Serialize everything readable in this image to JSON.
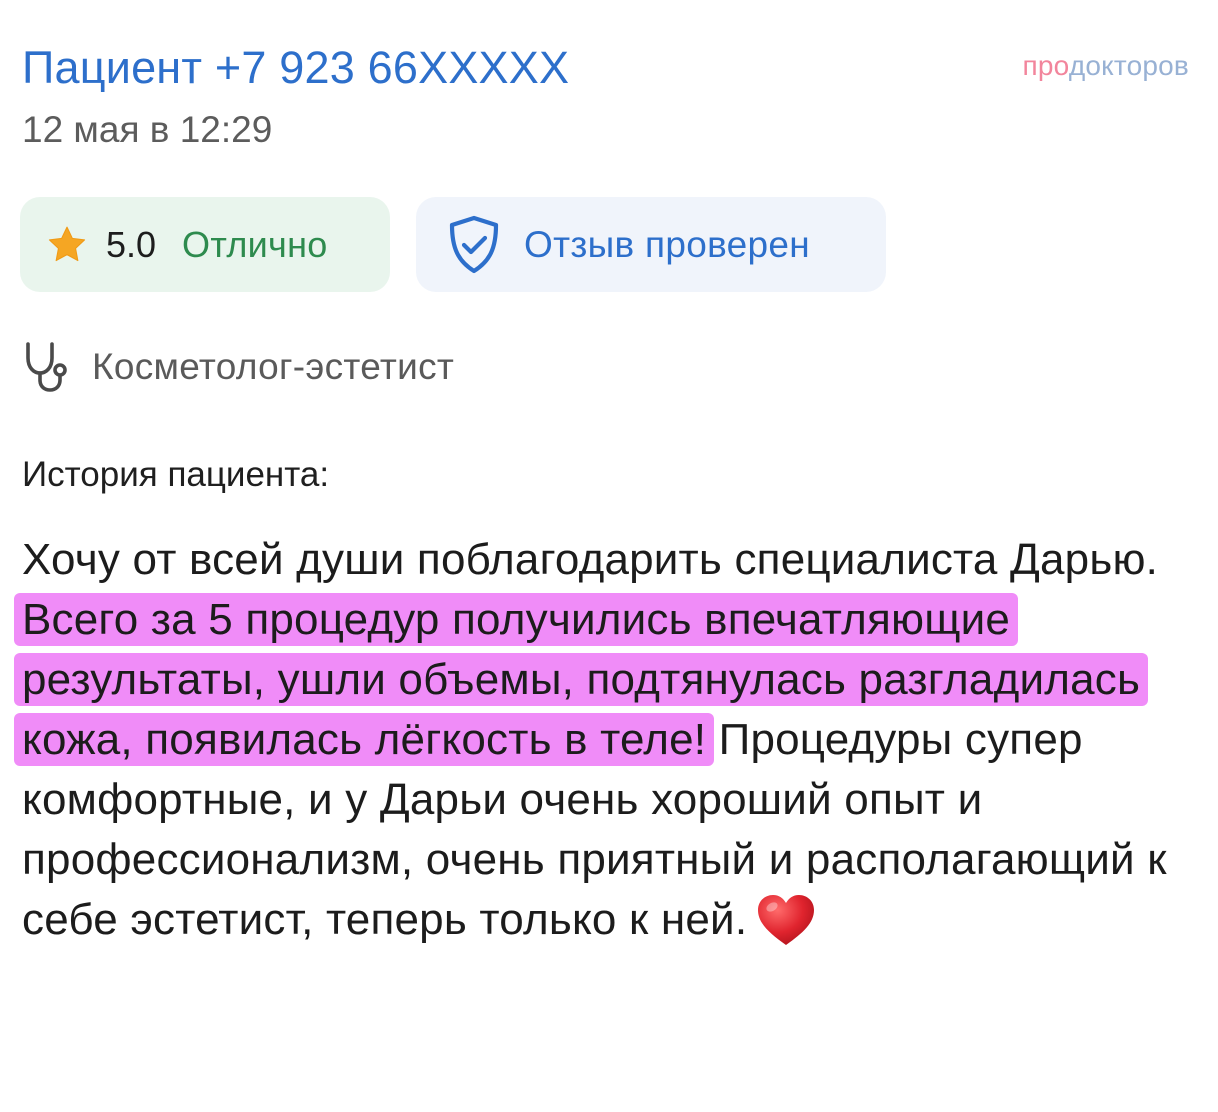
{
  "header": {
    "patient_name": "Пациент +7 923 66XXXXX",
    "date": "12 мая в 12:29",
    "brand_part1": "про",
    "brand_part2": "докторов"
  },
  "badges": {
    "rating_value": "5.0",
    "rating_text": "Отлично",
    "verified_text": "Отзыв проверен"
  },
  "specialty": "Косметолог-эстетист",
  "story": {
    "title": "История пациента:",
    "text_before": "Хочу от всей души поблагодарить специалиста Дарью. ",
    "highlighted": "Всего за 5 процедур получились впечатляющие результаты, ушли объемы, подтянулась разгладилась кожа, появилась лёгкость в теле!",
    "text_after": " Процедуры супер комфортные, и у Дарьи очень хороший опыт и профессионализм, очень приятный и располагающий к себе эстетист, теперь только к ней."
  },
  "colors": {
    "name_blue": "#2d6fcb",
    "rating_green": "#2e8b4e",
    "highlight_pink": "#f08cf8",
    "star": "#f5a623",
    "heart": "#e0242e"
  },
  "icons": [
    "star-icon",
    "shield-check-icon",
    "stethoscope-icon",
    "heart-icon"
  ]
}
